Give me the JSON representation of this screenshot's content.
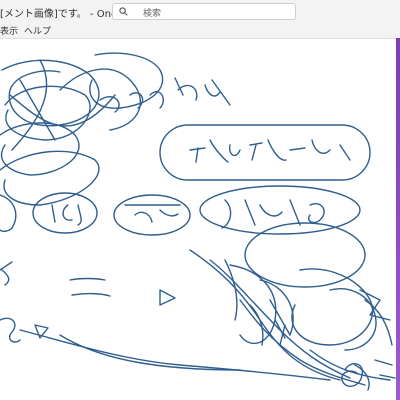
{
  "window": {
    "title": "[メント画像]です。 - OneNote",
    "search_placeholder": "検索"
  },
  "menu": {
    "items": [
      "表示",
      "ヘルプ"
    ]
  },
  "colors": {
    "ink": "#2f5f8f",
    "titlebar_bg": "#f3f3f3",
    "accent_strip": "#7b3db8"
  },
  "icons": {
    "search": "search-icon"
  }
}
